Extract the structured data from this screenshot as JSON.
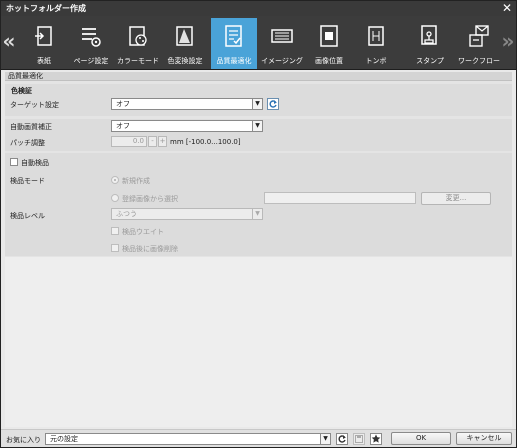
{
  "window": {
    "title": "ホットフォルダー作成",
    "close_glyph": "✕"
  },
  "toolbar": {
    "prev_glyph": "«",
    "next_glyph": "»",
    "tabs": [
      {
        "label": "表紙",
        "icon": "cover-icon"
      },
      {
        "label": "ページ設定",
        "icon": "page-setup-icon"
      },
      {
        "label": "カラーモード",
        "icon": "color-mode-icon"
      },
      {
        "label": "色変換設定",
        "icon": "color-conversion-icon"
      },
      {
        "label": "品質最適化",
        "icon": "quality-optimize-icon",
        "active": true
      },
      {
        "label": "イメージング",
        "icon": "imaging-icon"
      },
      {
        "label": "画像位置",
        "icon": "image-position-icon"
      },
      {
        "label": "トンボ",
        "icon": "crop-marks-icon"
      },
      {
        "label": "スタンプ",
        "icon": "stamp-icon"
      },
      {
        "label": "ワークフロー",
        "icon": "workflow-icon"
      }
    ]
  },
  "panel": {
    "header": "品質最適化",
    "color_verify": {
      "heading": "色検証",
      "target_label": "ターゲット設定",
      "target_value": "オフ"
    },
    "auto_quality": {
      "label": "自動画質補正",
      "value": "オフ",
      "patch_label": "パッチ調整",
      "patch_value": "0.0",
      "minus": "-",
      "plus": "+",
      "unit_range": "mm [-100.0...100.0]"
    },
    "auto_inspect": {
      "checkbox_label": "自動検品",
      "mode_label": "検品モード",
      "radio_new": "新規作成",
      "radio_registered": "登録画像から選択",
      "change_button": "変更...",
      "level_label": "検品レベル",
      "level_value": "ふつう",
      "wait_label": "検品ウエイト",
      "delete_label": "検品後に画像削除"
    }
  },
  "footer": {
    "favorites_label": "お気に入り",
    "favorites_value": "元の設定",
    "ok": "OK",
    "cancel": "キャンセル"
  },
  "colors": {
    "accent": "#4aa3d8",
    "toolbar": "#3c3c3c",
    "titlebar": "#3a3a3a"
  }
}
